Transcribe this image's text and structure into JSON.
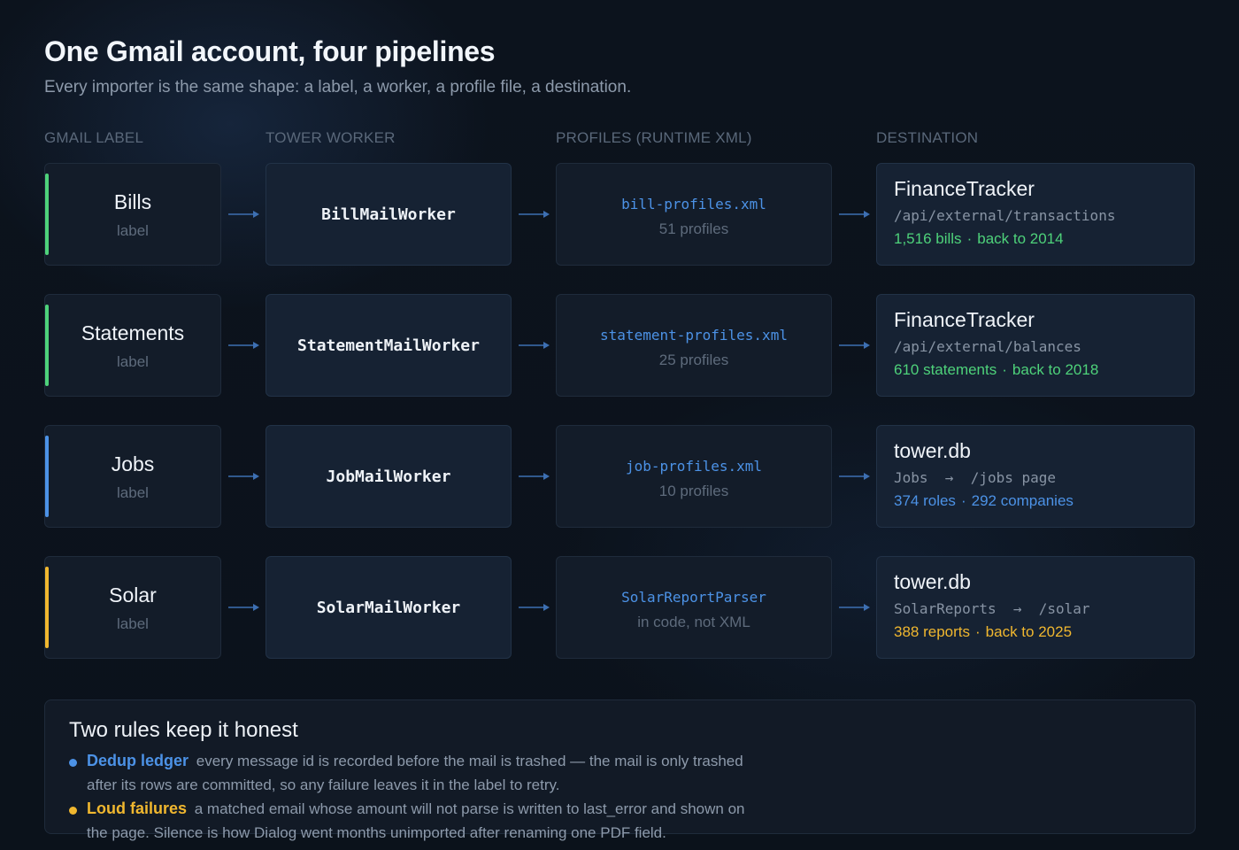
{
  "header": {
    "title": "One Gmail account, four pipelines",
    "subtitle": "Every importer is the same shape: a label, a worker, a profile file, a destination."
  },
  "columns": {
    "label": "GMAIL LABEL",
    "worker": "TOWER WORKER",
    "profiles": "PROFILES (RUNTIME XML)",
    "destination": "DESTINATION"
  },
  "colors": {
    "green": "#4ed27a",
    "blue": "#4c92e6",
    "yellow": "#f0b72f",
    "arrow": "#3d6fb2"
  },
  "pipelines": [
    {
      "label": "Bills",
      "label_sub": "label",
      "accent": "green",
      "worker": "BillMailWorker",
      "profile_file": "bill-profiles.xml",
      "profile_count": "51 profiles",
      "dest_name": "FinanceTracker",
      "dest_path": "/api/external/transactions",
      "stat_a": "1,516 bills",
      "stat_sep": "·",
      "stat_b": "back to 2014"
    },
    {
      "label": "Statements",
      "label_sub": "label",
      "accent": "green",
      "worker": "StatementMailWorker",
      "profile_file": "statement-profiles.xml",
      "profile_count": "25 profiles",
      "dest_name": "FinanceTracker",
      "dest_path": "/api/external/balances",
      "stat_a": "610 statements",
      "stat_sep": "·",
      "stat_b": "back to 2018"
    },
    {
      "label": "Jobs",
      "label_sub": "label",
      "accent": "blue",
      "worker": "JobMailWorker",
      "profile_file": "job-profiles.xml",
      "profile_count": "10 profiles",
      "dest_name": "tower.db",
      "dest_path": "Jobs  →  /jobs page",
      "stat_a": "374 roles",
      "stat_sep": "·",
      "stat_b": "292 companies"
    },
    {
      "label": "Solar",
      "label_sub": "label",
      "accent": "yellow",
      "worker": "SolarMailWorker",
      "profile_file": "SolarReportParser",
      "profile_count": "in code, not XML",
      "dest_name": "tower.db",
      "dest_path": "SolarReports  →  /solar",
      "stat_a": "388 reports",
      "stat_sep": "·",
      "stat_b": "back to 2025"
    }
  ],
  "rules": {
    "title": "Two rules keep it honest",
    "items": [
      {
        "name": "Dedup ledger",
        "accent": "blue",
        "text": "every message id is recorded before the mail is trashed — the mail is only trashed after its rows are committed, so any failure leaves it in the label to retry."
      },
      {
        "name": "Loud failures",
        "accent": "yellow",
        "text": "a matched email whose amount will not parse is written to last_error and shown on the page. Silence is how Dialog went months unimported after renaming one PDF field."
      }
    ]
  }
}
